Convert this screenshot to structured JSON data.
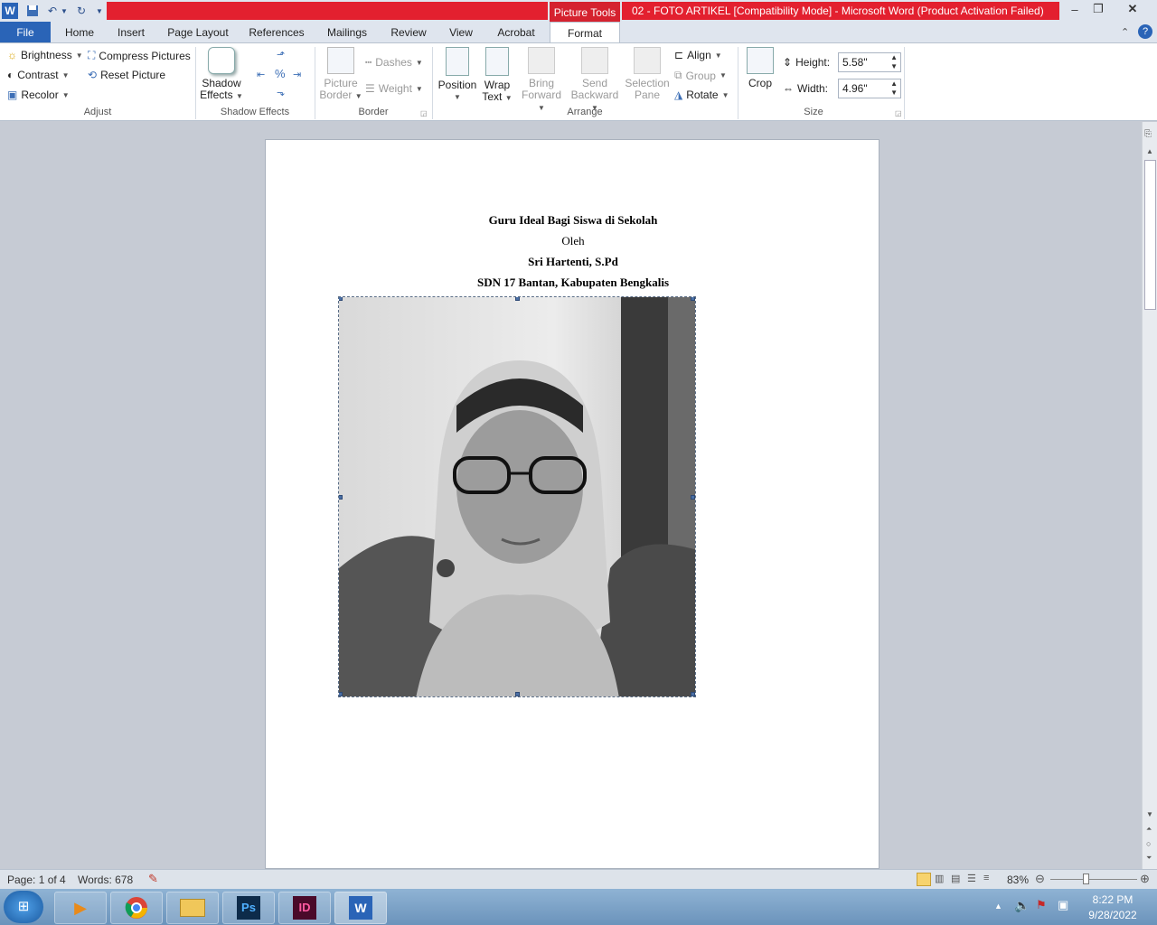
{
  "window": {
    "title": "02 - FOTO ARTIKEL [Compatibility Mode]  -  Microsoft Word (Product Activation Failed)",
    "contextual_tab_group": "Picture Tools",
    "app_icon": "W"
  },
  "tabs": [
    "File",
    "Home",
    "Insert",
    "Page Layout",
    "References",
    "Mailings",
    "Review",
    "View",
    "Acrobat",
    "Format"
  ],
  "ribbon": {
    "adjust": {
      "label": "Adjust",
      "brightness": "Brightness",
      "contrast": "Contrast",
      "recolor": "Recolor",
      "compress": "Compress Pictures",
      "reset": "Reset Picture"
    },
    "shadow": {
      "label": "Shadow Effects",
      "button_line1": "Shadow",
      "button_line2": "Effects"
    },
    "border": {
      "label": "Border",
      "picture_border_1": "Picture",
      "picture_border_2": "Border",
      "dashes": "Dashes",
      "weight": "Weight"
    },
    "arrange": {
      "label": "Arrange",
      "position": "Position",
      "wrap_1": "Wrap",
      "wrap_2": "Text",
      "bring_1": "Bring",
      "bring_2": "Forward",
      "send_1": "Send",
      "send_2": "Backward",
      "selection_1": "Selection",
      "selection_2": "Pane",
      "align": "Align",
      "group": "Group",
      "rotate": "Rotate"
    },
    "size": {
      "label": "Size",
      "crop": "Crop",
      "height_label": "Height:",
      "height_value": "5.58\"",
      "width_label": "Width:",
      "width_value": "4.96\""
    }
  },
  "document": {
    "title": "Guru Ideal Bagi Siswa di Sekolah",
    "by": "Oleh",
    "author": "Sri Hartenti, S.Pd",
    "school": "SDN 17 Bantan, Kabupaten Bengkalis"
  },
  "status": {
    "page": "Page: 1 of 4",
    "words": "Words: 678",
    "zoom": "83%"
  },
  "taskbar": {
    "time": "8:22 PM",
    "date": "9/28/2022",
    "apps": [
      "media-player",
      "chrome",
      "file-explorer",
      "photoshop",
      "indesign",
      "word"
    ]
  }
}
